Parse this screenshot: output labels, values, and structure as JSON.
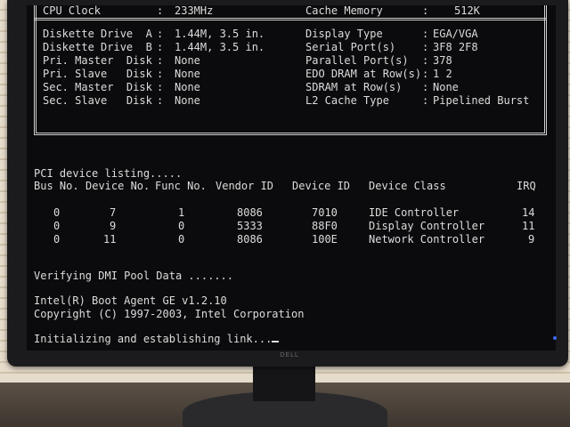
{
  "bios_summary": {
    "cpu_clock_label": "CPU Clock",
    "cpu_clock_value": "233MHz",
    "cache_memory_label": "Cache Memory",
    "cache_memory_value": "512K",
    "left_rows": [
      {
        "label": "Diskette Drive  A",
        "value": "1.44M, 3.5 in."
      },
      {
        "label": "Diskette Drive  B",
        "value": "1.44M, 3.5 in."
      },
      {
        "label": "Pri. Master  Disk",
        "value": "None"
      },
      {
        "label": "Pri. Slave   Disk",
        "value": "None"
      },
      {
        "label": "Sec. Master  Disk",
        "value": "None"
      },
      {
        "label": "Sec. Slave   Disk",
        "value": "None"
      }
    ],
    "right_rows": [
      {
        "label": "Display Type      ",
        "value": "EGA/VGA"
      },
      {
        "label": "Serial Port(s)    ",
        "value": "3F8 2F8"
      },
      {
        "label": "Parallel Port(s)  ",
        "value": "378"
      },
      {
        "label": "EDO DRAM at Row(s)",
        "value": "1 2"
      },
      {
        "label": "SDRAM at Row(s)   ",
        "value": "None"
      },
      {
        "label": "L2 Cache Type     ",
        "value": "Pipelined Burst"
      }
    ]
  },
  "pci": {
    "title": "PCI device listing.....",
    "headers": [
      "Bus No.",
      "Device No.",
      "Func No.",
      "Vendor ID",
      "Device ID",
      "Device Class",
      "IRQ"
    ],
    "rows": [
      [
        "0",
        "7",
        "1",
        "8086",
        "7010",
        "IDE Controller",
        "14"
      ],
      [
        "0",
        "9",
        "0",
        "5333",
        "88F0",
        "Display Controller",
        "11"
      ],
      [
        "0",
        "11",
        "0",
        "8086",
        "100E",
        "Network Controller",
        "9"
      ]
    ]
  },
  "messages": {
    "dmi": "Verifying DMI Pool Data .......",
    "boot_agent": "Intel(R) Boot Agent GE v1.2.10",
    "copyright": "Copyright (C) 1997-2003, Intel Corporation",
    "status": "Initializing and establishing link..."
  },
  "monitor": {
    "brand": "DELL"
  }
}
